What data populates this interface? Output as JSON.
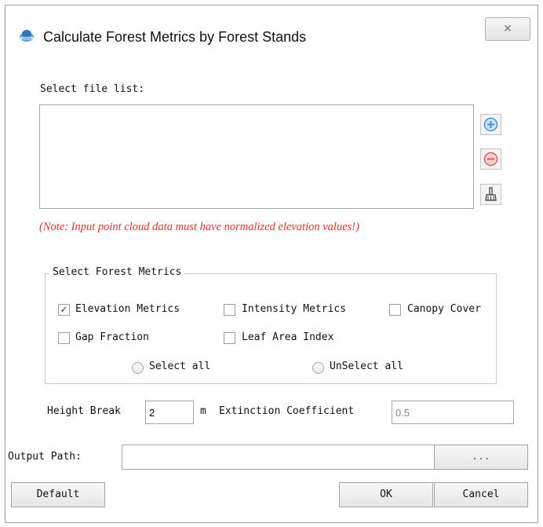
{
  "window": {
    "title": "Calculate Forest Metrics by Forest Stands",
    "close_glyph": "✕"
  },
  "files": {
    "label": "Select file list:",
    "items": [],
    "buttons": {
      "add_icon": "plus-circle-icon",
      "remove_icon": "minus-circle-icon",
      "clear_icon": "broom-icon"
    }
  },
  "note": "(Note: Input point cloud data must have normalized elevation values!)",
  "metrics": {
    "group_title": "Select Forest Metrics",
    "elevation": {
      "label": "Elevation Metrics",
      "checked": true
    },
    "intensity": {
      "label": "Intensity Metrics",
      "checked": false
    },
    "canopy": {
      "label": "Canopy Cover",
      "checked": false
    },
    "gap": {
      "label": "Gap Fraction",
      "checked": false
    },
    "lai": {
      "label": "Leaf Area Index",
      "checked": false
    },
    "select_all": "Select all",
    "unselect_all": "UnSelect all"
  },
  "params": {
    "height_break_label": "Height Break",
    "height_break_value": "2",
    "unit": "m",
    "extinction_label": "Extinction Coefficient",
    "extinction_value": "0.5"
  },
  "output": {
    "label": "Output Path:",
    "value": "",
    "browse_label": "..."
  },
  "buttons": {
    "default": "Default",
    "ok": "OK",
    "cancel": "Cancel"
  },
  "colors": {
    "note": "#e0312e",
    "add": "#4a90d9",
    "remove": "#e05a5a"
  }
}
